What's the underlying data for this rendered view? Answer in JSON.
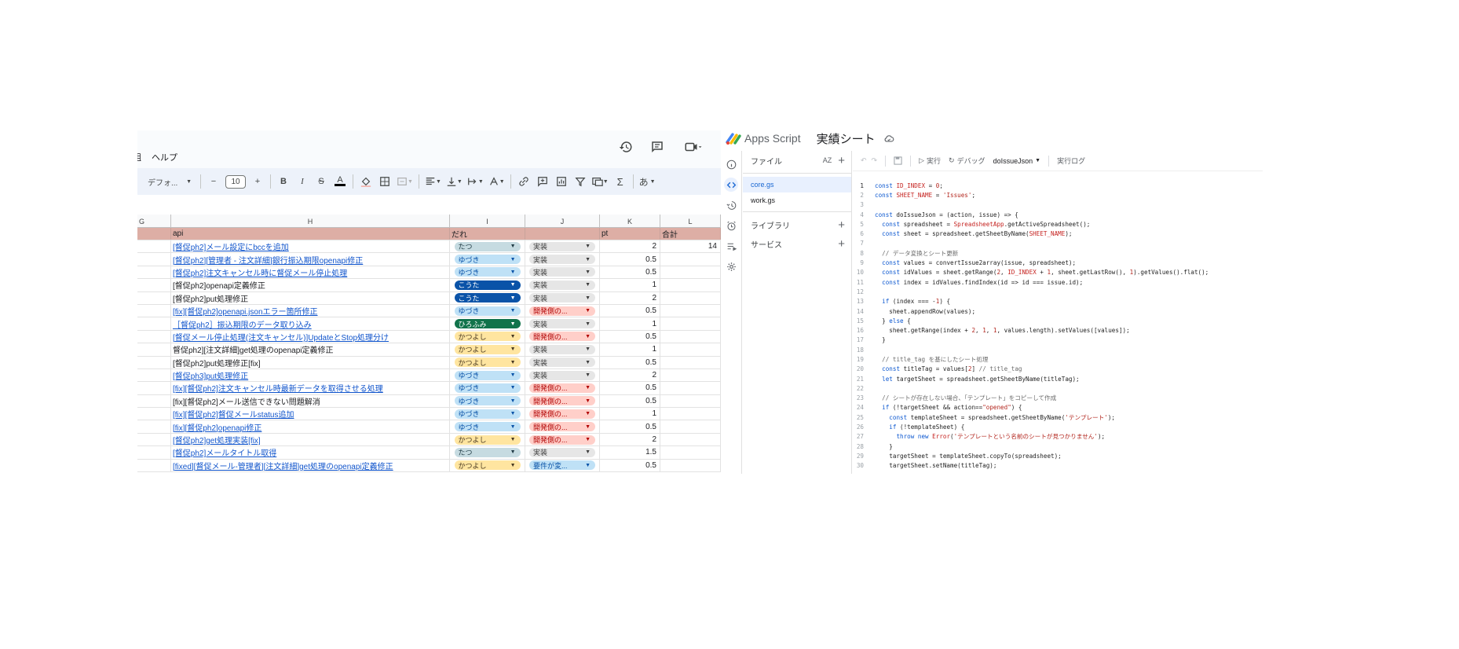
{
  "sheet": {
    "menu": {
      "left_item": "組",
      "help": "ヘルプ"
    },
    "toolbar": {
      "font": "デフォ...",
      "font_size": "10"
    },
    "columns": [
      "G",
      "H",
      "I",
      "J",
      "K",
      "L"
    ],
    "header": {
      "h": "api",
      "i": "だれ",
      "j": "",
      "k": "pt",
      "l": "合計"
    },
    "rows": [
      {
        "task": "[督促ph2]メール設定にbccを追加",
        "link": true,
        "who": "たつ",
        "status": "実装",
        "pt": "2",
        "total": "14"
      },
      {
        "task": "[督促ph2][管理者 - 注文詳細]銀行振込期限openapi修正",
        "link": true,
        "who": "ゆづき",
        "status": "実装",
        "pt": "0.5",
        "total": ""
      },
      {
        "task": "[督促ph2]注文キャンセル時に督促メール停止処理",
        "link": true,
        "who": "ゆづき",
        "status": "実装",
        "pt": "0.5",
        "total": ""
      },
      {
        "task": "[督促ph2]openapi定義修正",
        "link": false,
        "who": "こうた",
        "status": "実装",
        "pt": "1",
        "total": ""
      },
      {
        "task": "[督促ph2]put処理修正",
        "link": false,
        "who": "こうた",
        "status": "実装",
        "pt": "2",
        "total": ""
      },
      {
        "task": "[fix][督促ph2]openapi.jsonエラー箇所修正",
        "link": true,
        "who": "ゆづき",
        "status": "開発側の...",
        "pt": "0.5",
        "total": ""
      },
      {
        "task": "［督促ph2］振込期限のデータ取り込み",
        "link": true,
        "who": "ひろふみ",
        "status": "実装",
        "pt": "1",
        "total": ""
      },
      {
        "task": "[督促メール停止処理(注文キャンセル)]UpdateとStop処理分け",
        "link": true,
        "who": "かつよし",
        "status": "開発側の...",
        "pt": "0.5",
        "total": ""
      },
      {
        "task": "督促ph2][注文詳細]get処理のopenapi定義修正",
        "link": false,
        "who": "かつよし",
        "status": "実装",
        "pt": "1",
        "total": ""
      },
      {
        "task": "[督促ph2]put処理修正[fix]",
        "link": false,
        "who": "かつよし",
        "status": "実装",
        "pt": "0.5",
        "total": ""
      },
      {
        "task": "[督促ph3]put処理修正",
        "link": true,
        "who": "ゆづき",
        "status": "実装",
        "pt": "2",
        "total": ""
      },
      {
        "task": "[fix][督促ph2]注文キャンセル時最新データを取得させる処理",
        "link": true,
        "who": "ゆづき",
        "status": "開発側の...",
        "pt": "0.5",
        "total": ""
      },
      {
        "task": "[fix][督促ph2]メール送信できない問題解消",
        "link": false,
        "who": "ゆづき",
        "status": "開発側の...",
        "pt": "0.5",
        "total": ""
      },
      {
        "task": "[fix][督促ph2]督促メールstatus追加",
        "link": true,
        "who": "ゆづき",
        "status": "開発側の...",
        "pt": "1",
        "total": ""
      },
      {
        "task": "[fix][督促ph2]openapi修正",
        "link": true,
        "who": "ゆづき",
        "status": "開発側の...",
        "pt": "0.5",
        "total": ""
      },
      {
        "task": "[督促ph2]get処理実装[fix]",
        "link": true,
        "who": "かつよし",
        "status": "開発側の...",
        "pt": "2",
        "total": ""
      },
      {
        "task": "[督促ph2]メールタイトル取得",
        "link": true,
        "who": "たつ",
        "status": "実装",
        "pt": "1.5",
        "total": ""
      },
      {
        "task": "[fixed][督促メール-管理者][注文詳細]get処理のopenapi定義修正",
        "link": true,
        "who": "かつよし",
        "status": "要件が変...",
        "pt": "0.5",
        "total": ""
      }
    ],
    "who_colors": {
      "たつ": {
        "bg": "#c6dbe1",
        "fg": "#1f3a44"
      },
      "ゆづき": {
        "bg": "#bfe1f6",
        "fg": "#0a53a8"
      },
      "こうた": {
        "bg": "#0a53a8",
        "fg": "#ffffff"
      },
      "ひろふみ": {
        "bg": "#11734b",
        "fg": "#ffffff"
      },
      "かつよし": {
        "bg": "#ffe5a0",
        "fg": "#473821"
      }
    },
    "status_colors": {
      "実装": {
        "bg": "#e6e6e6",
        "fg": "#3c3c3c"
      },
      "開発側の...": {
        "bg": "#ffcfc9",
        "fg": "#b10202"
      },
      "要件が変...": {
        "bg": "#bfe1f6",
        "fg": "#0a53a8"
      }
    }
  },
  "gas": {
    "app_name": "Apps Script",
    "project": "実績シート",
    "files_label": "ファイル",
    "sort_label": "AZ",
    "files": [
      "core.gs",
      "work.gs"
    ],
    "library_label": "ライブラリ",
    "services_label": "サービス",
    "run_label": "実行",
    "debug_label": "デバッグ",
    "function_name": "doIssueJson",
    "log_label": "実行ログ",
    "code_lines": [
      "const ID_INDEX = 0;",
      "const SHEET_NAME = 'Issues';",
      "",
      "const doIssueJson = (action, issue) => {",
      "  const spreadsheet = SpreadsheetApp.getActiveSpreadsheet();",
      "  const sheet = spreadsheet.getSheetByName(SHEET_NAME);",
      "",
      "  // データ変換とシート更新",
      "  const values = convertIssue2array(issue, spreadsheet);",
      "  const idValues = sheet.getRange(2, ID_INDEX + 1, sheet.getLastRow(), 1).getValues().flat();",
      "  const index = idValues.findIndex(id => id === issue.id);",
      "",
      "  if (index === -1) {",
      "    sheet.appendRow(values);",
      "  } else {",
      "    sheet.getRange(index + 2, 1, 1, values.length).setValues([values]);",
      "  }",
      "",
      "  // title_tag を基にしたシート処理",
      "  const titleTag = values[2] // title_tag",
      "  let targetSheet = spreadsheet.getSheetByName(titleTag);",
      "",
      "  // シートが存在しない場合、「テンプレート」をコピーして作成",
      "  if (!targetSheet && action==\"opened\") {",
      "    const templateSheet = spreadsheet.getSheetByName('テンプレート');",
      "    if (!templateSheet) {",
      "      throw new Error('テンプレートという名前のシートが見つかりません');",
      "    }",
      "    targetSheet = templateSheet.copyTo(spreadsheet);",
      "    targetSheet.setName(titleTag);"
    ]
  }
}
